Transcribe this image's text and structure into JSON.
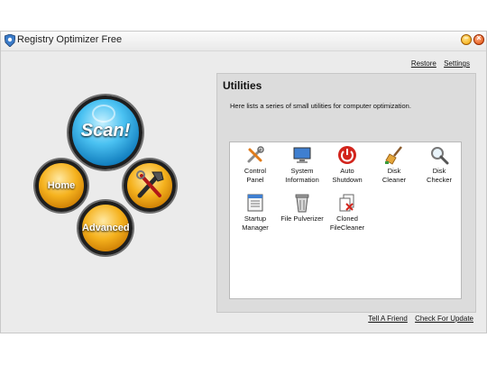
{
  "window": {
    "title": "Registry Optimizer Free"
  },
  "top_links": {
    "restore": "Restore",
    "settings": "Settings"
  },
  "nav": {
    "scan": "Scan!",
    "home": "Home",
    "advanced": "Advanced"
  },
  "utilities": {
    "title": "Utilities",
    "description": "Here lists a series of small utilities for computer optimization.",
    "items": [
      {
        "label": "Control\nPanel",
        "icon": "control-panel-icon"
      },
      {
        "label": "System\nInformation",
        "icon": "monitor-icon"
      },
      {
        "label": "Auto\nShutdown",
        "icon": "power-icon"
      },
      {
        "label": "Disk\nCleaner",
        "icon": "broom-icon"
      },
      {
        "label": "Disk\nChecker",
        "icon": "magnifier-icon"
      },
      {
        "label": "Startup\nManager",
        "icon": "startup-list-icon"
      },
      {
        "label": "File Pulverizer",
        "icon": "shredder-icon"
      },
      {
        "label": "Cloned\nFileCleaner",
        "icon": "cloned-file-icon"
      }
    ]
  },
  "bottom_links": {
    "tell_friend": "Tell A Friend",
    "check_update": "Check For Update"
  }
}
